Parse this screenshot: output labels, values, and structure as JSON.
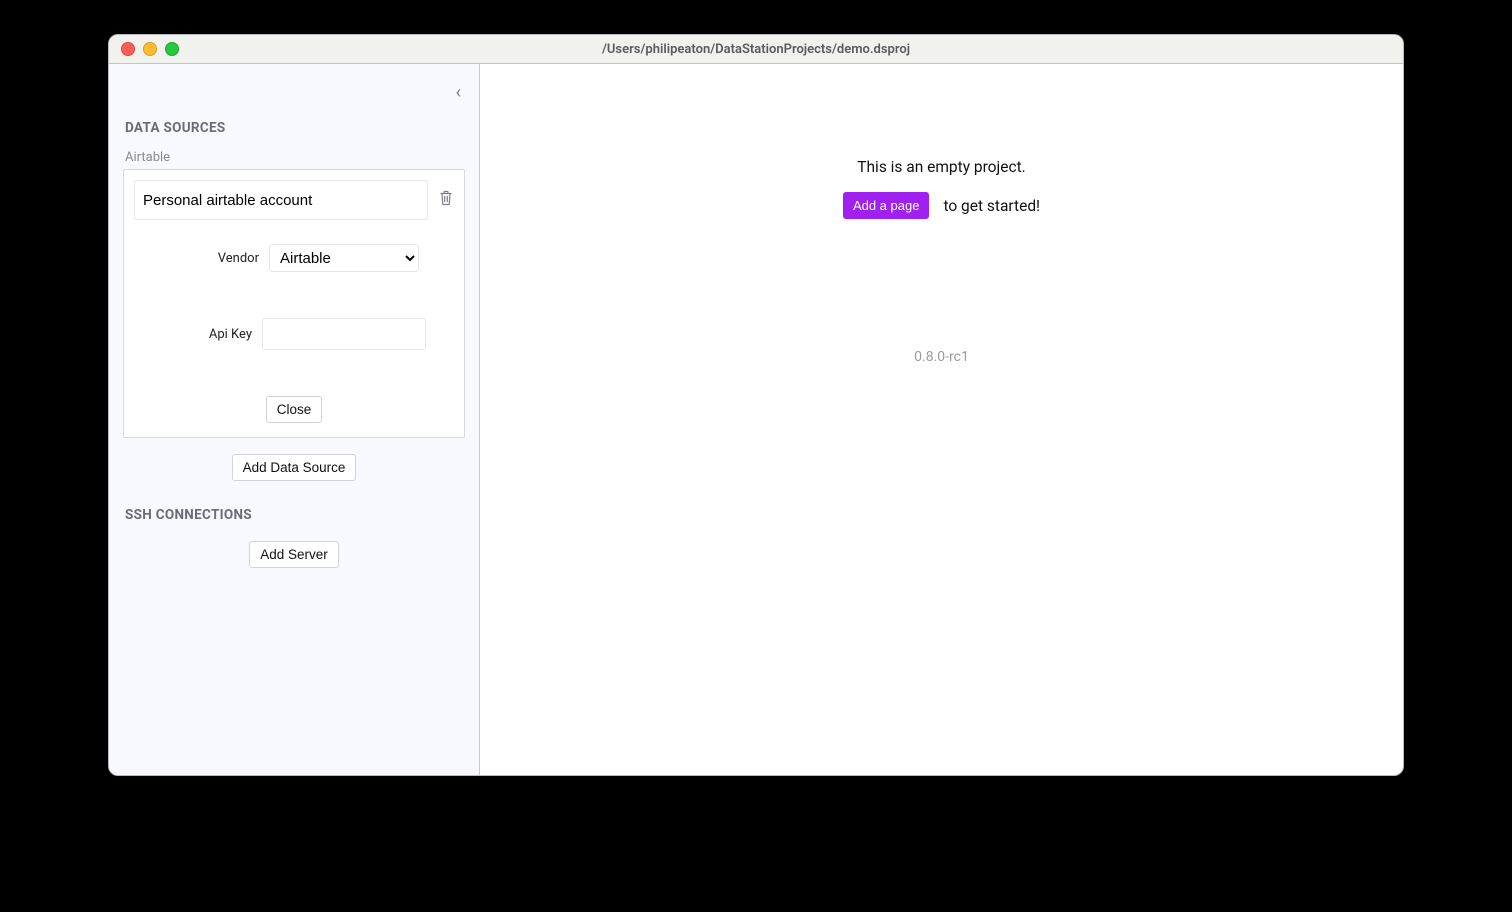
{
  "window": {
    "title": "/Users/philipeaton/DataStationProjects/demo.dsproj"
  },
  "sidebar": {
    "sections": {
      "data_sources": {
        "title": "DATA SOURCES",
        "source_type_label": "Airtable",
        "card": {
          "name_value": "Personal airtable account",
          "vendor_label": "Vendor",
          "vendor_options": [
            "Airtable"
          ],
          "vendor_selected": "Airtable",
          "apikey_label": "Api Key",
          "apikey_value": "",
          "close_label": "Close"
        },
        "add_button_label": "Add Data Source"
      },
      "ssh": {
        "title": "SSH CONNECTIONS",
        "add_button_label": "Add Server"
      }
    }
  },
  "main": {
    "empty_message": "This is an empty project.",
    "add_page_label": "Add a page",
    "cta_suffix": "to get started!",
    "version": "0.8.0-rc1"
  }
}
